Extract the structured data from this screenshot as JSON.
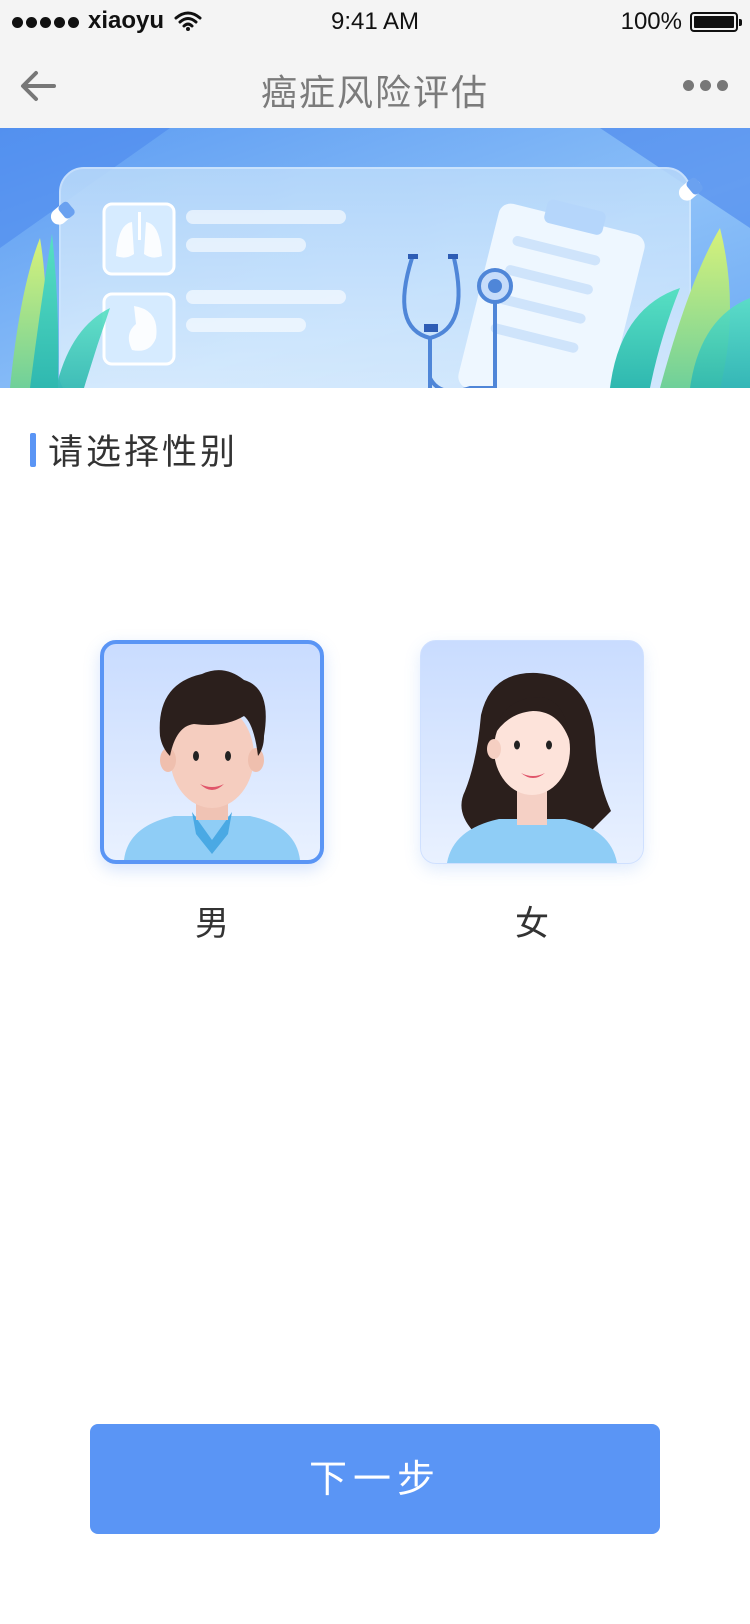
{
  "status_bar": {
    "carrier": "xiaoyu",
    "time": "9:41 AM",
    "battery": "100%"
  },
  "nav": {
    "title": "癌症风险评估",
    "back_icon": "arrow-left-icon",
    "more_icon": "more-dots-icon"
  },
  "section": {
    "title": "请选择性别"
  },
  "genders": [
    {
      "label": "男",
      "selected": true
    },
    {
      "label": "女",
      "selected": false
    }
  ],
  "next_button": {
    "label": "下一步"
  },
  "colors": {
    "accent": "#5a95f5",
    "nav_bg": "#f4f4f4",
    "title_gray": "#7b7b7b"
  }
}
